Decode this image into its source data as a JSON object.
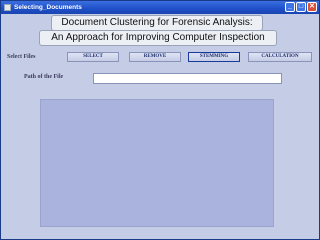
{
  "window": {
    "title": "Selecting_Documents",
    "controls": {
      "minimize": "_",
      "maximize": "□",
      "close": "✕"
    }
  },
  "heading": {
    "line1": "Document Clustering for Forensic Analysis:",
    "line2": "An Approach for Improving Computer Inspection"
  },
  "toolbar": {
    "label": "Select Files",
    "buttons": {
      "select": "SELECT",
      "remove": "REMOVE",
      "stemming": "STEMMING",
      "calculation": "CALCULATION"
    }
  },
  "path": {
    "label": "Path of the File",
    "value": ""
  },
  "files_list": {
    "items": []
  }
}
